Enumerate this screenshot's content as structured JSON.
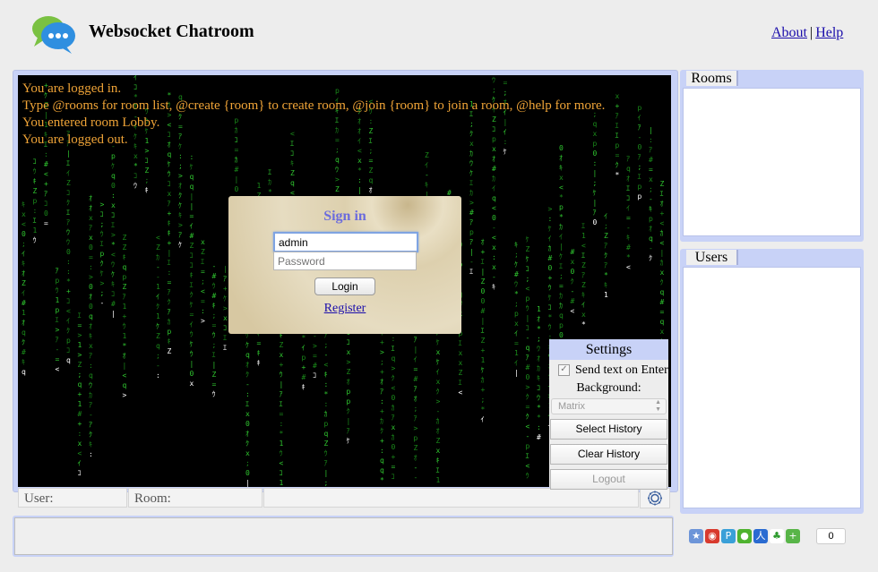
{
  "header": {
    "title": "Websocket Chatroom",
    "about_link": "About",
    "separator": "|",
    "help_link": "Help"
  },
  "chat": {
    "messages": [
      "You are logged in.",
      "Type @rooms for room list, @create {room} to create room, @join {room} to join a room, @help for more.",
      "You entered room Lobby.",
      "You are logged out."
    ],
    "message_color": "#f0a437",
    "background": "Matrix"
  },
  "signin": {
    "title": "Sign in",
    "username_value": "admin",
    "password_placeholder": "Password",
    "login_button": "Login",
    "register_link": "Register"
  },
  "settings": {
    "title": "Settings",
    "send_on_enter_label": "Send text on Enter",
    "send_on_enter_checked": true,
    "background_label": "Background:",
    "background_selected": "Matrix",
    "select_history_button": "Select History",
    "clear_history_button": "Clear History",
    "logout_button": "Logout"
  },
  "status_bar": {
    "user_label": "User:",
    "room_label": "Room:",
    "gear_icon": "gear-icon"
  },
  "sidebar": {
    "rooms_title": "Rooms",
    "users_title": "Users"
  },
  "share": {
    "count": "0"
  },
  "colors": {
    "accent_panel": "#c8d2f7",
    "signin_title": "#6c6cdd",
    "link": "#1a0dab"
  }
}
